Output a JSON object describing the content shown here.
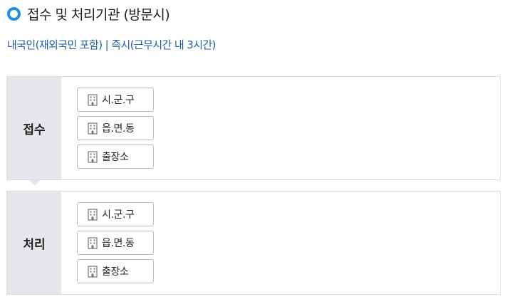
{
  "header": {
    "title": "접수 및 처리기관 (방문시)",
    "subtitle": "내국인(재외국민 포함) | 즉시(근무시간 내 3시간)"
  },
  "sections": [
    {
      "label": "접수",
      "offices": [
        "시.군.구",
        "읍.면.동",
        "출장소"
      ]
    },
    {
      "label": "처리",
      "offices": [
        "시.군.구",
        "읍.면.동",
        "출장소"
      ]
    }
  ],
  "colors": {
    "accent": "#1b8fe8",
    "subtitle": "#1f5fa8",
    "label_bg": "#e6e7ea"
  },
  "icons": {
    "bullet": "circle-bullet-icon",
    "office": "building-icon"
  }
}
